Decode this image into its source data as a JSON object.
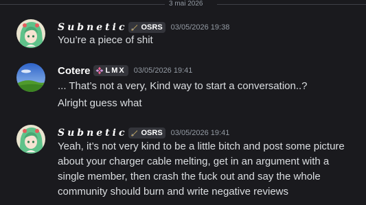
{
  "date_divider": "3 mai 2026",
  "messages": [
    {
      "username": "Subnetic",
      "tag": "OSRS",
      "timestamp": "03/05/2026 19:38",
      "lines": [
        "You’re a piece of shit"
      ]
    },
    {
      "username": "Cotere",
      "tag": "LMX",
      "timestamp": "03/05/2026 19:41",
      "lines": [
        "... That’s not a very, Kind way to start a conversation..?",
        "Alright guess what"
      ]
    },
    {
      "username": "Subnetic",
      "tag": "OSRS",
      "timestamp": "03/05/2026 19:41",
      "lines": [
        "Yeah, it’s not very kind to be a little bitch and post some picture",
        "about your charger cable melting, get in an argument with a",
        "single member, then crash the fuck out and say the whole",
        "community should burn and write negative reviews"
      ]
    }
  ],
  "icons": {
    "osrs_tag": "sword-icon",
    "lmx_tag": "diamond-cluster-icon",
    "subnetic_avatar": "anime-girl-avatar",
    "cotere_avatar": "landscape-avatar"
  }
}
